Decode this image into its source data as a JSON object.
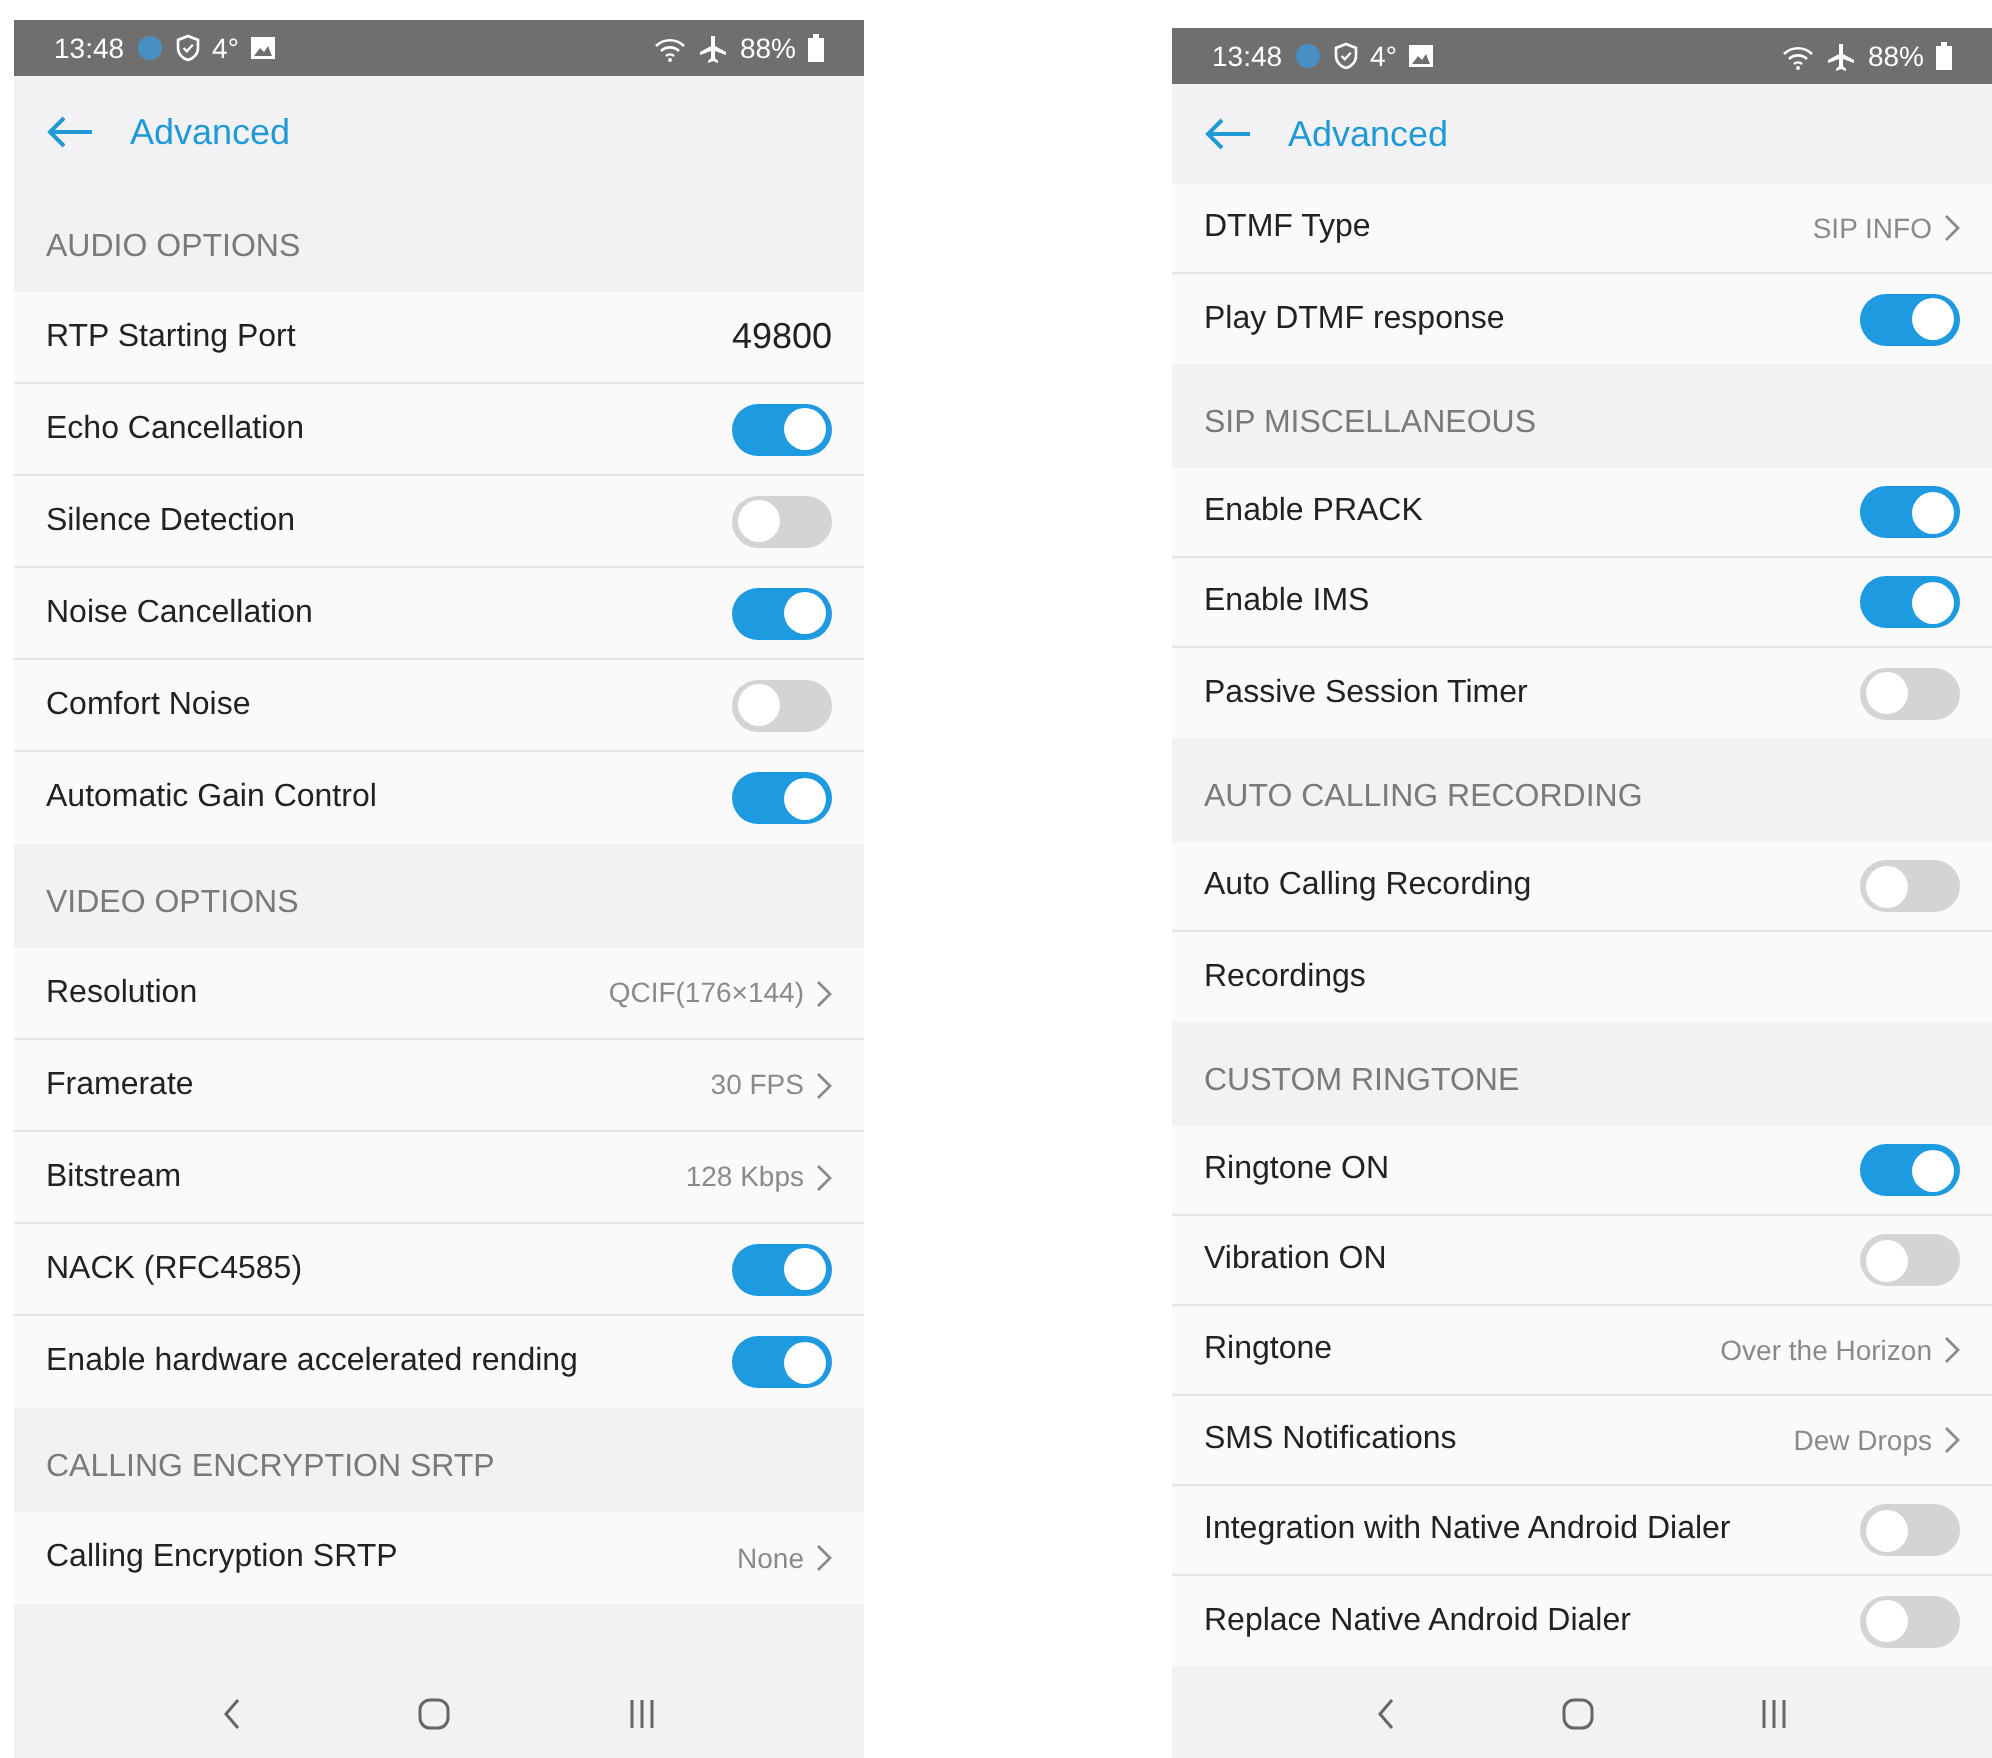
{
  "phones": [
    {
      "status_bar": {
        "time": "13:48",
        "temperature": "4°",
        "battery": "88%"
      },
      "app_bar": {
        "title": "Advanced"
      },
      "items": [
        {
          "kind": "header",
          "label": "AUDIO OPTIONS"
        },
        {
          "kind": "value",
          "label": "RTP Starting Port",
          "value": "49800"
        },
        {
          "kind": "toggle",
          "label": "Echo Cancellation",
          "on": true
        },
        {
          "kind": "toggle",
          "label": "Silence Detection",
          "on": false
        },
        {
          "kind": "toggle",
          "label": "Noise Cancellation",
          "on": true
        },
        {
          "kind": "toggle",
          "label": "Comfort Noise",
          "on": false
        },
        {
          "kind": "toggle",
          "label": "Automatic Gain Control",
          "on": true
        },
        {
          "kind": "header",
          "label": "VIDEO OPTIONS"
        },
        {
          "kind": "link",
          "label": "Resolution",
          "value": "QCIF(176×144)"
        },
        {
          "kind": "link",
          "label": "Framerate",
          "value": "30 FPS"
        },
        {
          "kind": "link",
          "label": "Bitstream",
          "value": "128 Kbps"
        },
        {
          "kind": "toggle",
          "label": "NACK (RFC4585)",
          "on": true
        },
        {
          "kind": "toggle",
          "label": "Enable hardware accelerated rending",
          "on": true
        },
        {
          "kind": "header",
          "label": "CALLING ENCRYPTION SRTP"
        },
        {
          "kind": "link",
          "label": "Calling Encryption SRTP",
          "value": "None"
        }
      ]
    },
    {
      "status_bar": {
        "time": "13:48",
        "temperature": "4°",
        "battery": "88%"
      },
      "app_bar": {
        "title": "Advanced"
      },
      "items": [
        {
          "kind": "link",
          "label": "DTMF Type",
          "value": "SIP INFO"
        },
        {
          "kind": "toggle",
          "label": "Play DTMF response",
          "on": true
        },
        {
          "kind": "header",
          "label": "SIP MISCELLANEOUS"
        },
        {
          "kind": "toggle",
          "label": "Enable PRACK",
          "on": true
        },
        {
          "kind": "toggle",
          "label": "Enable IMS",
          "on": true
        },
        {
          "kind": "toggle",
          "label": "Passive Session Timer",
          "on": false
        },
        {
          "kind": "header",
          "label": "AUTO CALLING RECORDING"
        },
        {
          "kind": "toggle",
          "label": "Auto Calling Recording",
          "on": false
        },
        {
          "kind": "plain",
          "label": "Recordings"
        },
        {
          "kind": "header",
          "label": "CUSTOM RINGTONE"
        },
        {
          "kind": "toggle",
          "label": "Ringtone ON",
          "on": true
        },
        {
          "kind": "toggle",
          "label": "Vibration ON",
          "on": false
        },
        {
          "kind": "link",
          "label": "Ringtone",
          "value": "Over the Horizon"
        },
        {
          "kind": "link",
          "label": "SMS Notifications",
          "value": "Dew Drops"
        },
        {
          "kind": "toggle",
          "label": "Integration with Native Android Dialer",
          "on": false
        },
        {
          "kind": "toggle",
          "label": "Replace Native Android Dialer",
          "on": false
        }
      ]
    }
  ]
}
